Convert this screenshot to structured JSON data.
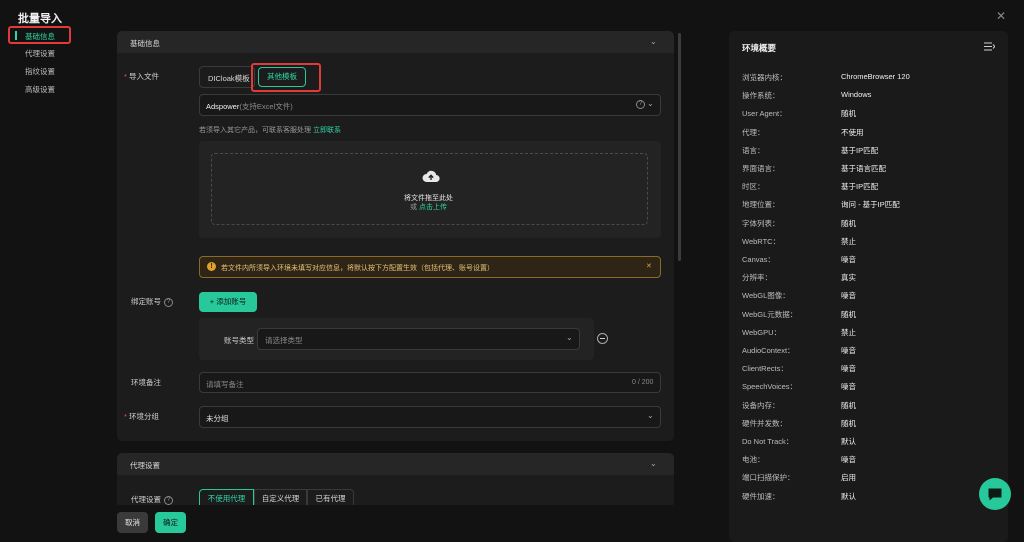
{
  "dialog": {
    "title": "批量导入"
  },
  "nav": {
    "items": [
      "基础信息",
      "代理设置",
      "指纹设置",
      "高级设置"
    ]
  },
  "basic": {
    "section_title": "基础信息",
    "import_file_label": "导入文件",
    "tabs": [
      "DICloak模板",
      "其他模板"
    ],
    "select_value": "Adspower",
    "select_hint": "(支持Excel文件)",
    "info_text": "若须导入其它产品，可联系客服处理",
    "contact_link": "立即联系",
    "upload_text": "将文件拖至此处",
    "upload_or": "或",
    "upload_link": "点击上传",
    "warning_text": "若文件内所须导入环境未填写对应信息，将默认按下方配置生效（包括代理、账号设置）",
    "bind_account_label": "绑定账号",
    "add_account_button": "+ 添加账号",
    "account_type_label": "账号类型",
    "account_type_placeholder": "请选择类型",
    "remark_label": "环境备注",
    "remark_placeholder": "请填写备注",
    "remark_count": "0 / 200",
    "group_label": "环境分组",
    "group_value": "未分组"
  },
  "proxy": {
    "section_title": "代理设置",
    "label": "代理设置",
    "options": [
      "不使用代理",
      "自定义代理",
      "已有代理"
    ]
  },
  "footer": {
    "cancel": "取消",
    "confirm": "确定"
  },
  "overview": {
    "title": "环境概要",
    "rows": [
      {
        "k": "浏览器内核：",
        "v": "ChromeBrowser 120"
      },
      {
        "k": "操作系统：",
        "v": "Windows"
      },
      {
        "k": "User Agent：",
        "v": "随机"
      },
      {
        "k": "代理：",
        "v": "不使用"
      },
      {
        "k": "语言：",
        "v": "基于IP匹配"
      },
      {
        "k": "界面语言：",
        "v": "基于语言匹配"
      },
      {
        "k": "时区：",
        "v": "基于IP匹配"
      },
      {
        "k": "地理位置：",
        "v": "询问 - 基于IP匹配"
      },
      {
        "k": "字体列表：",
        "v": "随机"
      },
      {
        "k": "WebRTC：",
        "v": "禁止"
      },
      {
        "k": "Canvas：",
        "v": "噪音"
      },
      {
        "k": "分辨率：",
        "v": "真实"
      },
      {
        "k": "WebGL图像：",
        "v": "噪音"
      },
      {
        "k": "WebGL元数据：",
        "v": "随机"
      },
      {
        "k": "WebGPU：",
        "v": "禁止"
      },
      {
        "k": "AudioContext：",
        "v": "噪音"
      },
      {
        "k": "ClientRects：",
        "v": "噪音"
      },
      {
        "k": "SpeechVoices：",
        "v": "噪音"
      },
      {
        "k": "设备内存：",
        "v": "随机"
      },
      {
        "k": "硬件并发数：",
        "v": "随机"
      },
      {
        "k": "Do Not Track：",
        "v": "默认"
      },
      {
        "k": "电池：",
        "v": "噪音"
      },
      {
        "k": "端口扫描保护：",
        "v": "启用"
      },
      {
        "k": "硬件加速：",
        "v": "默认"
      }
    ]
  },
  "colors": {
    "accent": "#27c99a",
    "highlight": "#e03a3a",
    "warning": "#e0a12a"
  }
}
